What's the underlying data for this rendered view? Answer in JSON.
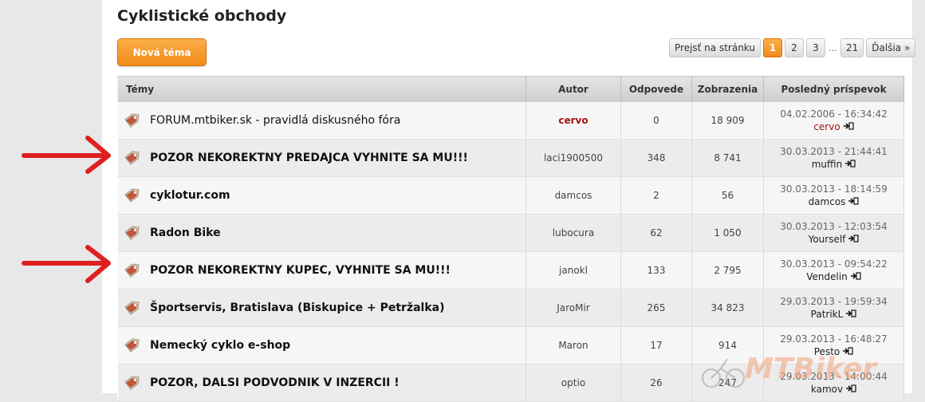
{
  "page": {
    "title": "Cyklistické obchody",
    "new_topic_label": "Nová téma"
  },
  "pagination": {
    "jump_label": "Prejsť na stránku",
    "current": "1",
    "pages": [
      "2",
      "3"
    ],
    "ellipsis": "…",
    "last": "21",
    "next_label": "Ďalšia »"
  },
  "table": {
    "headers": {
      "topics": "Témy",
      "author": "Autor",
      "replies": "Odpovede",
      "views": "Zobrazenia",
      "last_post": "Posledný príspevok"
    },
    "rows": [
      {
        "title": "FORUM.mtbiker.sk - pravidlá diskusného fóra",
        "author": "cervo",
        "replies": "0",
        "views": "18 909",
        "last_date": "04.02.2006 - 16:34:42",
        "last_user": "cervo"
      },
      {
        "title": "POZOR NEKOREKTNY PREDAJCA VYHNITE SA MU!!!",
        "author": "laci1900500",
        "replies": "348",
        "views": "8 741",
        "last_date": "30.03.2013 - 21:44:41",
        "last_user": "muffin"
      },
      {
        "title": "cyklotur.com",
        "author": "damcos",
        "replies": "2",
        "views": "56",
        "last_date": "30.03.2013 - 18:14:59",
        "last_user": "damcos"
      },
      {
        "title": "Radon Bike",
        "author": "lubocura",
        "replies": "62",
        "views": "1 050",
        "last_date": "30.03.2013 - 12:03:54",
        "last_user": "Yourself"
      },
      {
        "title": "POZOR NEKOREKTNY KUPEC, VYHNITE SA MU!!!",
        "author": "janokl",
        "replies": "133",
        "views": "2 795",
        "last_date": "30.03.2013 - 09:54:22",
        "last_user": "Vendelin"
      },
      {
        "title": "Športservis, Bratislava (Biskupice + Petržalka)",
        "author": "JaroMir",
        "replies": "265",
        "views": "34 823",
        "last_date": "29.03.2013 - 19:59:34",
        "last_user": "PatrikL"
      },
      {
        "title": "Nemecký cyklo e-shop",
        "author": "Maron",
        "replies": "17",
        "views": "914",
        "last_date": "29.03.2013 - 16:48:27",
        "last_user": "Pesto"
      },
      {
        "title": "POZOR, DALSI PODVODNIK V INZERCII !",
        "author": "optio",
        "replies": "26",
        "views": "247",
        "last_date": "29.03.2013 - 14:00:44",
        "last_user": "kamov"
      }
    ]
  },
  "watermark": {
    "text": "MTBiker"
  },
  "colors": {
    "accent_orange": "#f08a18",
    "highlight_red": "#a51212",
    "arrow_red": "#e02020"
  },
  "icons": {
    "topic": "tag-icon",
    "goto_last": "goto-arrow-icon",
    "annotation": "red-arrow"
  }
}
